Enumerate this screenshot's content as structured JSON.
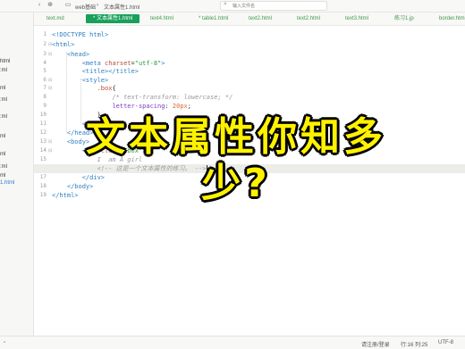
{
  "topbar": {
    "breadcrumb_root": "web基础",
    "breadcrumb_file": "文本属性1.html",
    "search_placeholder": "输入文件名"
  },
  "tabs": [
    {
      "label": "text.md",
      "active": false
    },
    {
      "label": "* 文本属性1.html",
      "active": true
    },
    {
      "label": "text4.html",
      "active": false
    },
    {
      "label": "* table1.html",
      "active": false
    },
    {
      "label": "text2.html",
      "active": false
    },
    {
      "label": "text2.html",
      "active": false
    },
    {
      "label": "text3.html",
      "active": false
    },
    {
      "label": "练习1.jp",
      "active": false
    },
    {
      "label": "border.htm",
      "active": false
    }
  ],
  "sidebar": {
    "files": [
      "html",
      ":ml",
      "ml",
      ":ml",
      ":ml",
      "ml",
      "ml",
      ":ml",
      "ml",
      "1.html"
    ]
  },
  "editor": {
    "lines": [
      {
        "num": "1",
        "fold": "",
        "html": "<span class=\"k\">&lt;!DOCTYPE html&gt;</span>"
      },
      {
        "num": "2",
        "fold": "⊟",
        "html": "<span class=\"t\">&lt;html&gt;</span>"
      },
      {
        "num": "3",
        "fold": "⊟",
        "html": "    <span class=\"t\">&lt;head&gt;</span>"
      },
      {
        "num": "4",
        "fold": "",
        "html": "        <span class=\"t\">&lt;meta</span> <span class=\"a\">charset</span>=<span class=\"s\">\"utf-8\"</span><span class=\"t\">&gt;</span>"
      },
      {
        "num": "5",
        "fold": "",
        "html": "        <span class=\"t\">&lt;title&gt;&lt;/title&gt;</span>"
      },
      {
        "num": "6",
        "fold": "⊟",
        "html": "        <span class=\"t\">&lt;style&gt;</span>"
      },
      {
        "num": "7",
        "fold": "⊟",
        "html": "            <span class=\"a\">.box</span>{"
      },
      {
        "num": "8",
        "fold": "",
        "html": "                <span class=\"c\">/* text-transform: lowercase; */</span>"
      },
      {
        "num": "9",
        "fold": "",
        "html": "                <span class=\"p\">letter-spacing</span>: <span class=\"n\">20px</span>;"
      },
      {
        "num": "10",
        "fold": "",
        "html": "            }"
      },
      {
        "num": "11",
        "fold": "",
        "html": "        <span class=\"t\">&lt;/style&gt;</span>"
      },
      {
        "num": "12",
        "fold": "",
        "html": "    <span class=\"t\">&lt;/head&gt;</span>"
      },
      {
        "num": "13",
        "fold": "⊟",
        "html": "    <span class=\"t\">&lt;body&gt;</span>"
      },
      {
        "num": "14",
        "fold": "⊟",
        "html": "        <span class=\"t\">&lt;div</span> <span class=\"a\">class</span>=<span class=\"s\">\"box\"</span><span class=\"t\">&gt;</span>"
      },
      {
        "num": "15",
        "fold": "",
        "html": "            <span class=\"c\">I  am A girl</span>"
      },
      {
        "num": "16",
        "fold": "",
        "html": "            <span class=\"c\">&lt;!-- 这是一个文本属性的练习。 --&gt;</span>"
      },
      {
        "num": "17",
        "fold": "",
        "html": "        <span class=\"t\">&lt;/div&gt;</span>"
      },
      {
        "num": "18",
        "fold": "",
        "html": "    <span class=\"t\">&lt;/body&gt;</span>"
      },
      {
        "num": "19",
        "fold": "",
        "html": "<span class=\"t\">&lt;/html&gt;</span>"
      }
    ],
    "highlight_line": 16
  },
  "overlay": {
    "title": "文本属性你知多少?"
  },
  "status": {
    "login": "请注册/登录",
    "position": "行:16  列:25",
    "encoding": "UTF-8"
  },
  "colors": {
    "accent": "#19a05a",
    "overlay_text": "#fff200",
    "tag": "#2f7fbf",
    "string": "#2c9a3c"
  }
}
